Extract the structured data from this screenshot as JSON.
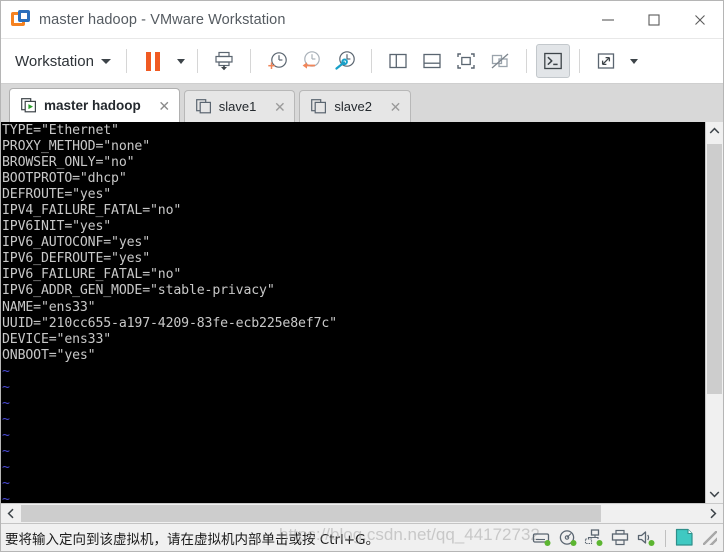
{
  "window": {
    "title": "master hadoop - VMware Workstation",
    "logo_icon": "vmware-logo-icon",
    "minimize_label": "—",
    "maximize_label": "□",
    "close_label": "✕"
  },
  "toolbar": {
    "workstation_menu": "Workstation",
    "items": [
      {
        "name": "pause-vm-button",
        "icon": "pause-icon"
      },
      {
        "name": "pause-dropdown-button",
        "icon": "chevron-down-icon"
      },
      {
        "name": "send-ctrl-alt-del-button",
        "icon": "print-download-icon"
      },
      {
        "name": "take-snapshot-button",
        "icon": "snapshot-add-icon"
      },
      {
        "name": "revert-snapshot-button",
        "icon": "snapshot-revert-icon"
      },
      {
        "name": "snapshot-manager-button",
        "icon": "snapshot-manager-icon"
      },
      {
        "name": "show-library-button",
        "icon": "panel-left-icon"
      },
      {
        "name": "show-thumbnails-button",
        "icon": "panel-bottom-icon"
      },
      {
        "name": "full-screen-button",
        "icon": "fullscreen-icon"
      },
      {
        "name": "unity-mode-button",
        "icon": "unity-disabled-icon"
      },
      {
        "name": "console-view-button",
        "icon": "console-prompt-icon"
      },
      {
        "name": "stretch-guest-button",
        "icon": "expand-arrows-icon"
      },
      {
        "name": "stretch-dropdown-button",
        "icon": "chevron-down-icon"
      }
    ]
  },
  "tabs": [
    {
      "label": "master hadoop",
      "active": true,
      "icon": "vm-running-icon",
      "close": "✕"
    },
    {
      "label": "slave1",
      "active": false,
      "icon": "vm-stopped-icon",
      "close": "✕"
    },
    {
      "label": "slave2",
      "active": false,
      "icon": "vm-stopped-icon",
      "close": "✕"
    }
  ],
  "terminal": {
    "background_color": "#000000",
    "foreground_color": "#c8c8c8",
    "tilde_color": "#4b4bd8",
    "lines": [
      "TYPE=\"Ethernet\"",
      "PROXY_METHOD=\"none\"",
      "BROWSER_ONLY=\"no\"",
      "BOOTPROTO=\"dhcp\"",
      "DEFROUTE=\"yes\"",
      "IPV4_FAILURE_FATAL=\"no\"",
      "IPV6INIT=\"yes\"",
      "IPV6_AUTOCONF=\"yes\"",
      "IPV6_DEFROUTE=\"yes\"",
      "IPV6_FAILURE_FATAL=\"no\"",
      "IPV6_ADDR_GEN_MODE=\"stable-privacy\"",
      "NAME=\"ens33\"",
      "UUID=\"210cc655-a197-4209-83fe-ecb225e8ef7c\"",
      "DEVICE=\"ens33\"",
      "ONBOOT=\"yes\""
    ],
    "empty_marker": "~",
    "empty_marker_count": 9
  },
  "scrollbars": {
    "vertical": {
      "up_arrow": "⌃",
      "down_arrow": "⌄"
    },
    "horizontal": {
      "left_arrow": "‹",
      "right_arrow": "›"
    }
  },
  "statusbar": {
    "message": "要将输入定向到该虚拟机，请在虚拟机内部单击或按 Ctrl+G。",
    "watermark": "https://blog.csdn.net/qq_44172732",
    "icons": [
      {
        "name": "hard-disk-status-icon"
      },
      {
        "name": "cd-dvd-status-icon"
      },
      {
        "name": "network-adapter-status-icon"
      },
      {
        "name": "printer-status-icon"
      },
      {
        "name": "sound-card-status-icon"
      },
      {
        "name": "message-log-icon"
      }
    ]
  },
  "colors": {
    "accent_orange": "#f05a22",
    "logo_orange": "#f58220",
    "logo_blue": "#2a6ebb",
    "status_green": "#5cb531",
    "icon_gray": "#5a6570"
  }
}
